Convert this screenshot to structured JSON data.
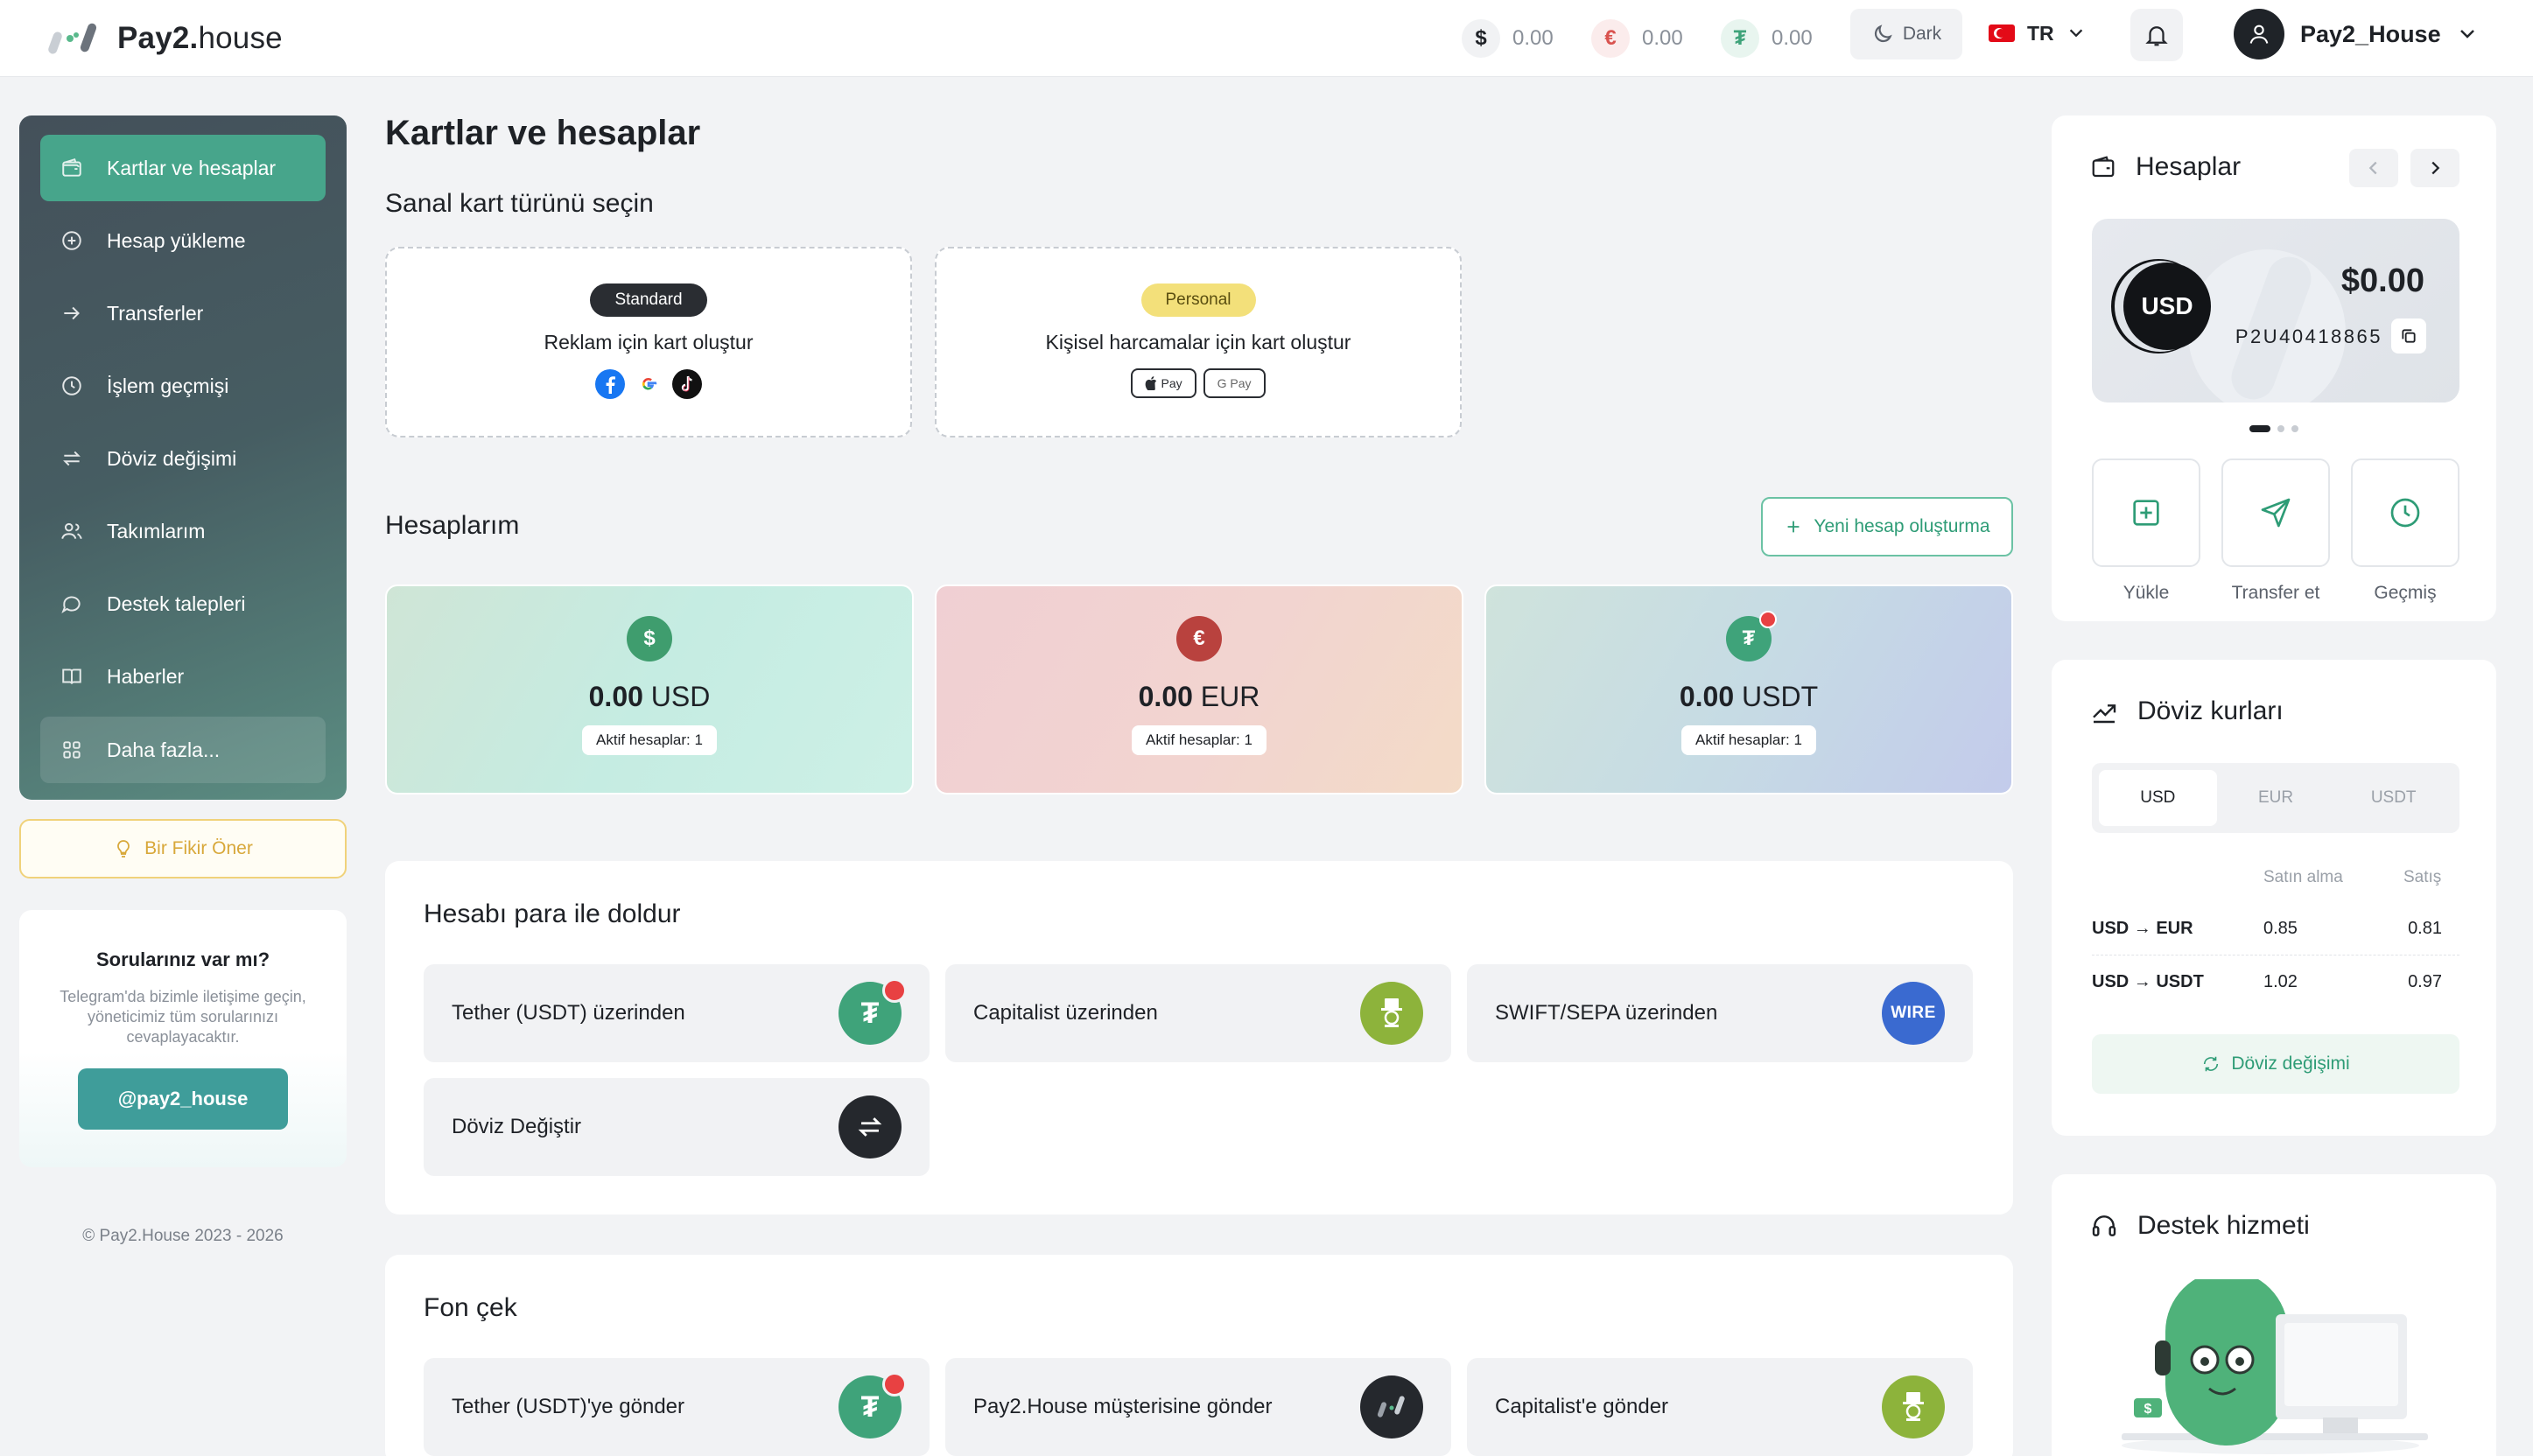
{
  "header": {
    "logo_brand": "Pay2.",
    "logo_suffix": "house",
    "balances": [
      {
        "symbol": "$",
        "value": "0.00",
        "color": "#1e2126"
      },
      {
        "symbol": "€",
        "value": "0.00",
        "color": "#d9534f"
      },
      {
        "symbol": "₮",
        "value": "0.00",
        "color": "#3fa37a"
      }
    ],
    "theme_label": "Dark",
    "language": "TR",
    "username": "Pay2_House"
  },
  "sidebar": {
    "items": [
      {
        "label": "Kartlar ve hesaplar",
        "icon": "wallet-icon"
      },
      {
        "label": "Hesap yükleme",
        "icon": "plus-circle-icon"
      },
      {
        "label": "Transferler",
        "icon": "arrow-right-icon"
      },
      {
        "label": "İşlem geçmişi",
        "icon": "clock-icon"
      },
      {
        "label": "Döviz değişimi",
        "icon": "exchange-icon"
      },
      {
        "label": "Takımlarım",
        "icon": "team-icon"
      },
      {
        "label": "Destek talepleri",
        "icon": "chat-icon"
      },
      {
        "label": "Haberler",
        "icon": "book-icon"
      },
      {
        "label": "Daha fazla...",
        "icon": "grid-icon"
      }
    ],
    "idea_button": "Bir Fikir Öner",
    "help": {
      "title": "Sorularınız var mı?",
      "text": "Telegram'da bizimle iletişime geçin, yöneticimiz tüm sorularınızı cevaplayacaktır.",
      "button": "@pay2_house"
    },
    "copyright": "© Pay2.House 2023 - 2026"
  },
  "main": {
    "title": "Kartlar ve hesaplar",
    "card_type_title": "Sanal kart türünü seçin",
    "card_types": [
      {
        "badge": "Standard",
        "desc": "Reklam için kart oluştur"
      },
      {
        "badge": "Personal",
        "desc": "Kişisel harcamalar için kart oluştur",
        "pay_labels": [
          "Pay",
          "G Pay"
        ]
      }
    ],
    "accounts_title": "Hesaplarım",
    "new_account_button": "Yeni hesap oluşturma",
    "accounts": [
      {
        "amount": "0.00",
        "currency": "USD",
        "active": "Aktif hesaplar: 1",
        "icon_symbol": "$",
        "icon_color": "#3f9d6e"
      },
      {
        "amount": "0.00",
        "currency": "EUR",
        "active": "Aktif hesaplar: 1",
        "icon_symbol": "€",
        "icon_color": "#b9423e"
      },
      {
        "amount": "0.00",
        "currency": "USDT",
        "active": "Aktif hesaplar: 1",
        "icon_symbol": "₮",
        "icon_color": "#3fa37a"
      }
    ],
    "topup": {
      "title": "Hesabı para ile doldur",
      "options": [
        "Tether (USDT) üzerinden",
        "Capitalist üzerinden",
        "SWIFT/SEPA üzerinden",
        "Döviz Değiştir"
      ],
      "wire_label": "WIRE"
    },
    "withdraw": {
      "title": "Fon çek",
      "options": [
        "Tether (USDT)'ye gönder",
        "Pay2.House müşterisine gönder",
        "Capitalist'e gönder"
      ]
    }
  },
  "right": {
    "accounts": {
      "title": "Hesaplar",
      "currency": "USD",
      "amount": "$0.00",
      "account_id": "P2U40418865",
      "actions": [
        "Yükle",
        "Transfer et",
        "Geçmiş"
      ]
    },
    "rates": {
      "title": "Döviz kurları",
      "tabs": [
        "USD",
        "EUR",
        "USDT"
      ],
      "col_buy": "Satın alma",
      "col_sell": "Satış",
      "rows": [
        {
          "pair": "USD → EUR",
          "buy": "0.85",
          "sell": "0.81"
        },
        {
          "pair": "USD → USDT",
          "buy": "1.02",
          "sell": "0.97"
        }
      ],
      "button": "Döviz değişimi"
    },
    "support": {
      "title": "Destek hizmeti"
    }
  }
}
